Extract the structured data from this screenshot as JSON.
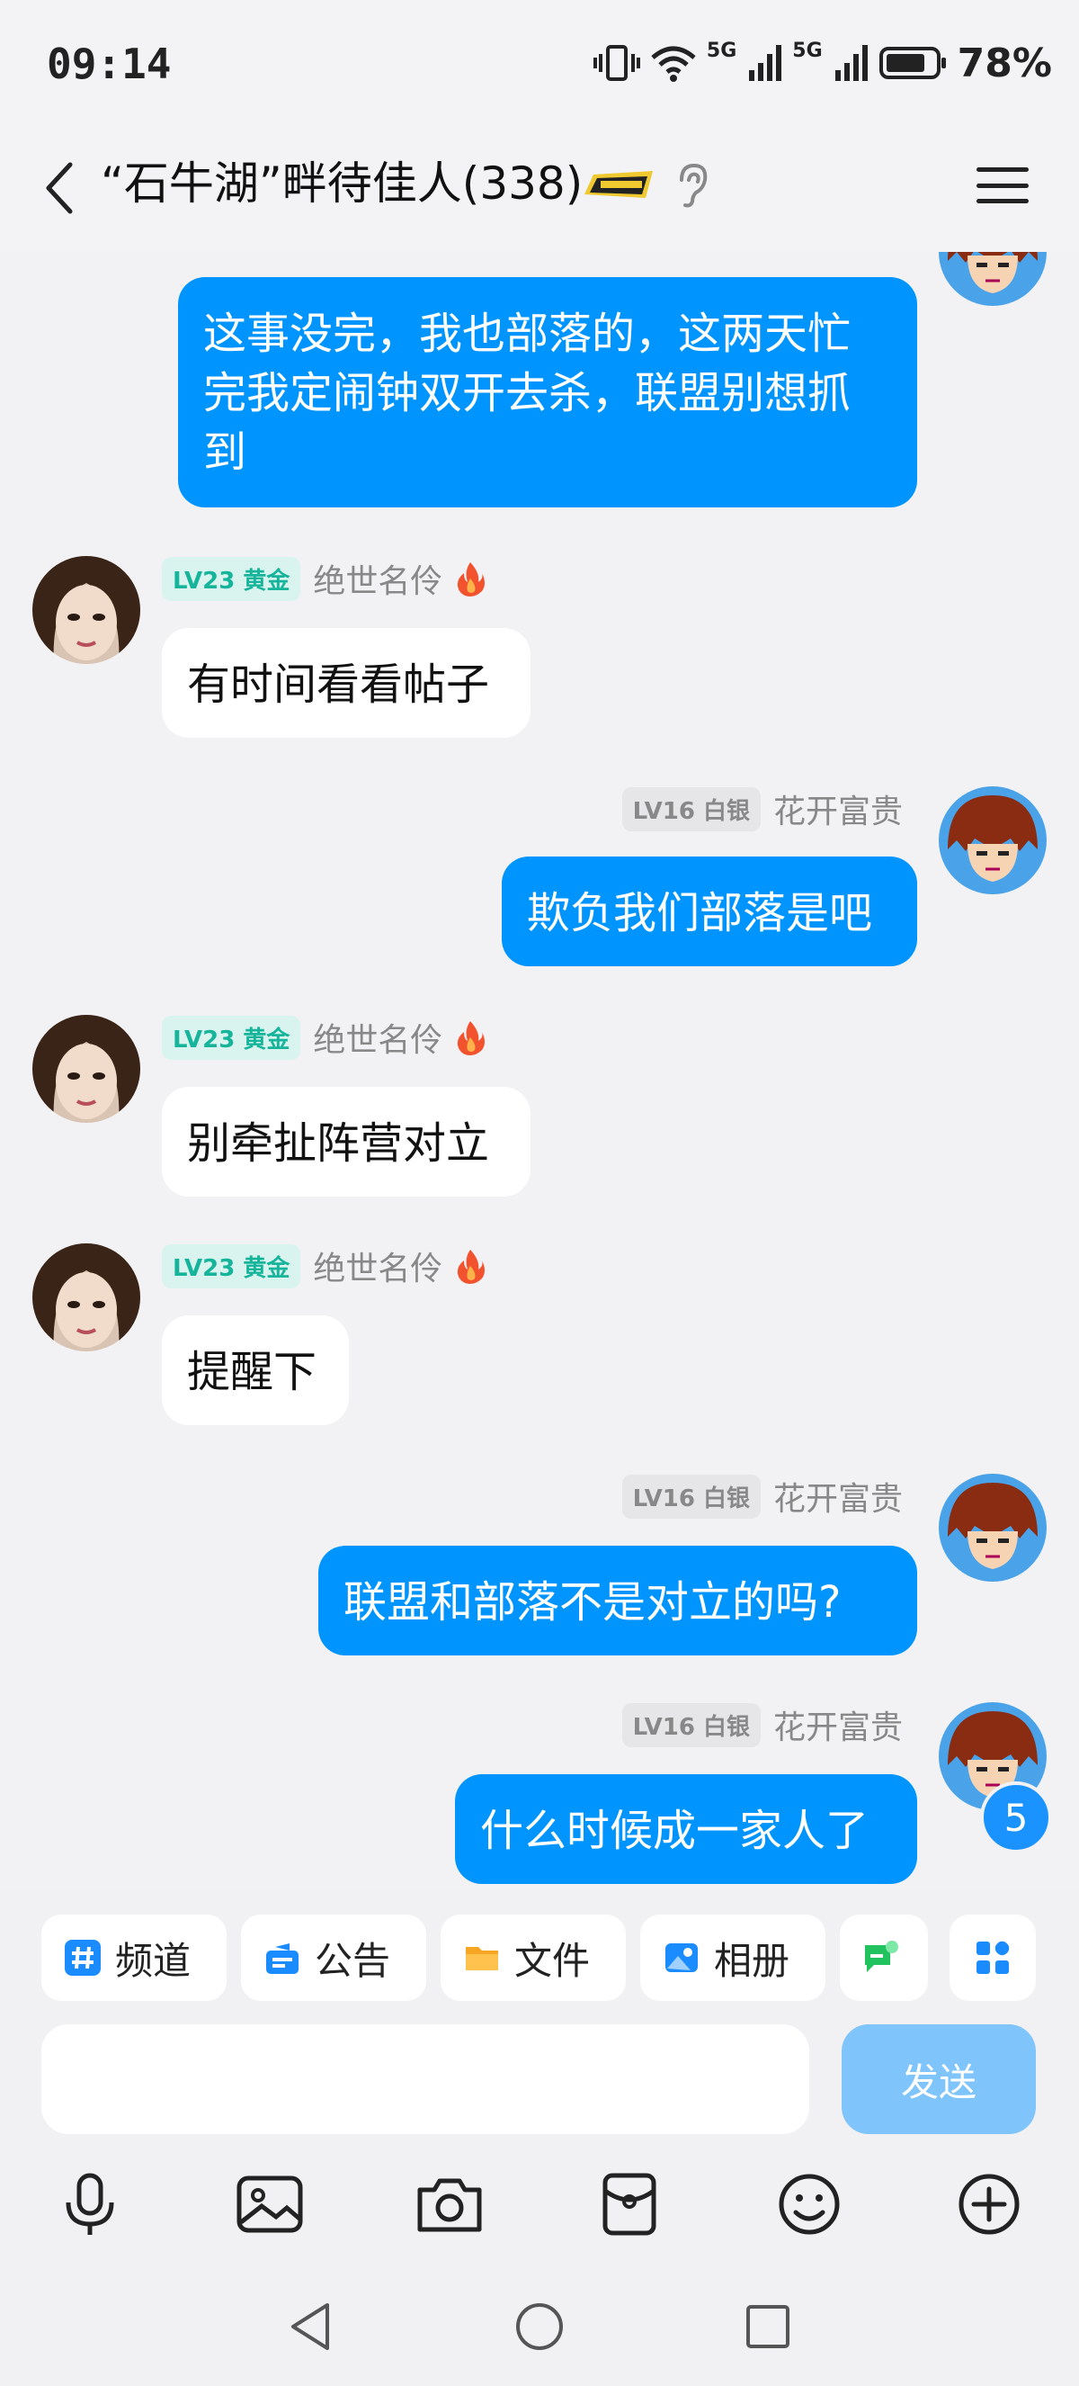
{
  "status_bar": {
    "time": "09:14",
    "signal1_tag": "5G",
    "signal2_tag": "5G",
    "battery": "78%"
  },
  "header": {
    "title": "“石牛湖”畔待佳人(338)"
  },
  "messages": [
    {
      "side": "me",
      "text_lines": [
        "这事没完，我也部落的，这两天忙",
        "完我定闹钟双开去杀，联盟别想抓",
        "到"
      ]
    },
    {
      "side": "them",
      "level": "LV23 黄金",
      "name": "绝世名伶",
      "text": "有时间看看帖子"
    },
    {
      "side": "me",
      "level": "LV16 白银",
      "name": "花开富贵",
      "text": "欺负我们部落是吧"
    },
    {
      "side": "them",
      "level": "LV23 黄金",
      "name": "绝世名伶",
      "text": "别牵扯阵营对立"
    },
    {
      "side": "them",
      "level": "LV23 黄金",
      "name": "绝世名伶",
      "text": "提醒下"
    },
    {
      "side": "me",
      "level": "LV16 白银",
      "name": "花开富贵",
      "text": "联盟和部落不是对立的吗?"
    },
    {
      "side": "me",
      "level": "LV16 白银",
      "name": "花开富贵",
      "text": "什么时候成一家人了"
    }
  ],
  "unread_count": "5",
  "shortcuts": [
    {
      "label": "频道",
      "icon": "hashtag-icon"
    },
    {
      "label": "公告",
      "icon": "announcement-icon"
    },
    {
      "label": "文件",
      "icon": "folder-icon"
    },
    {
      "label": "相册",
      "icon": "album-icon"
    },
    {
      "label": "",
      "icon": "chat-plus-icon"
    }
  ],
  "input": {
    "placeholder": "",
    "send_label": "发送"
  },
  "colors": {
    "accent": "#0094ff",
    "gold_badge": "#16b59b",
    "send_disabled": "#7fc4fb"
  }
}
